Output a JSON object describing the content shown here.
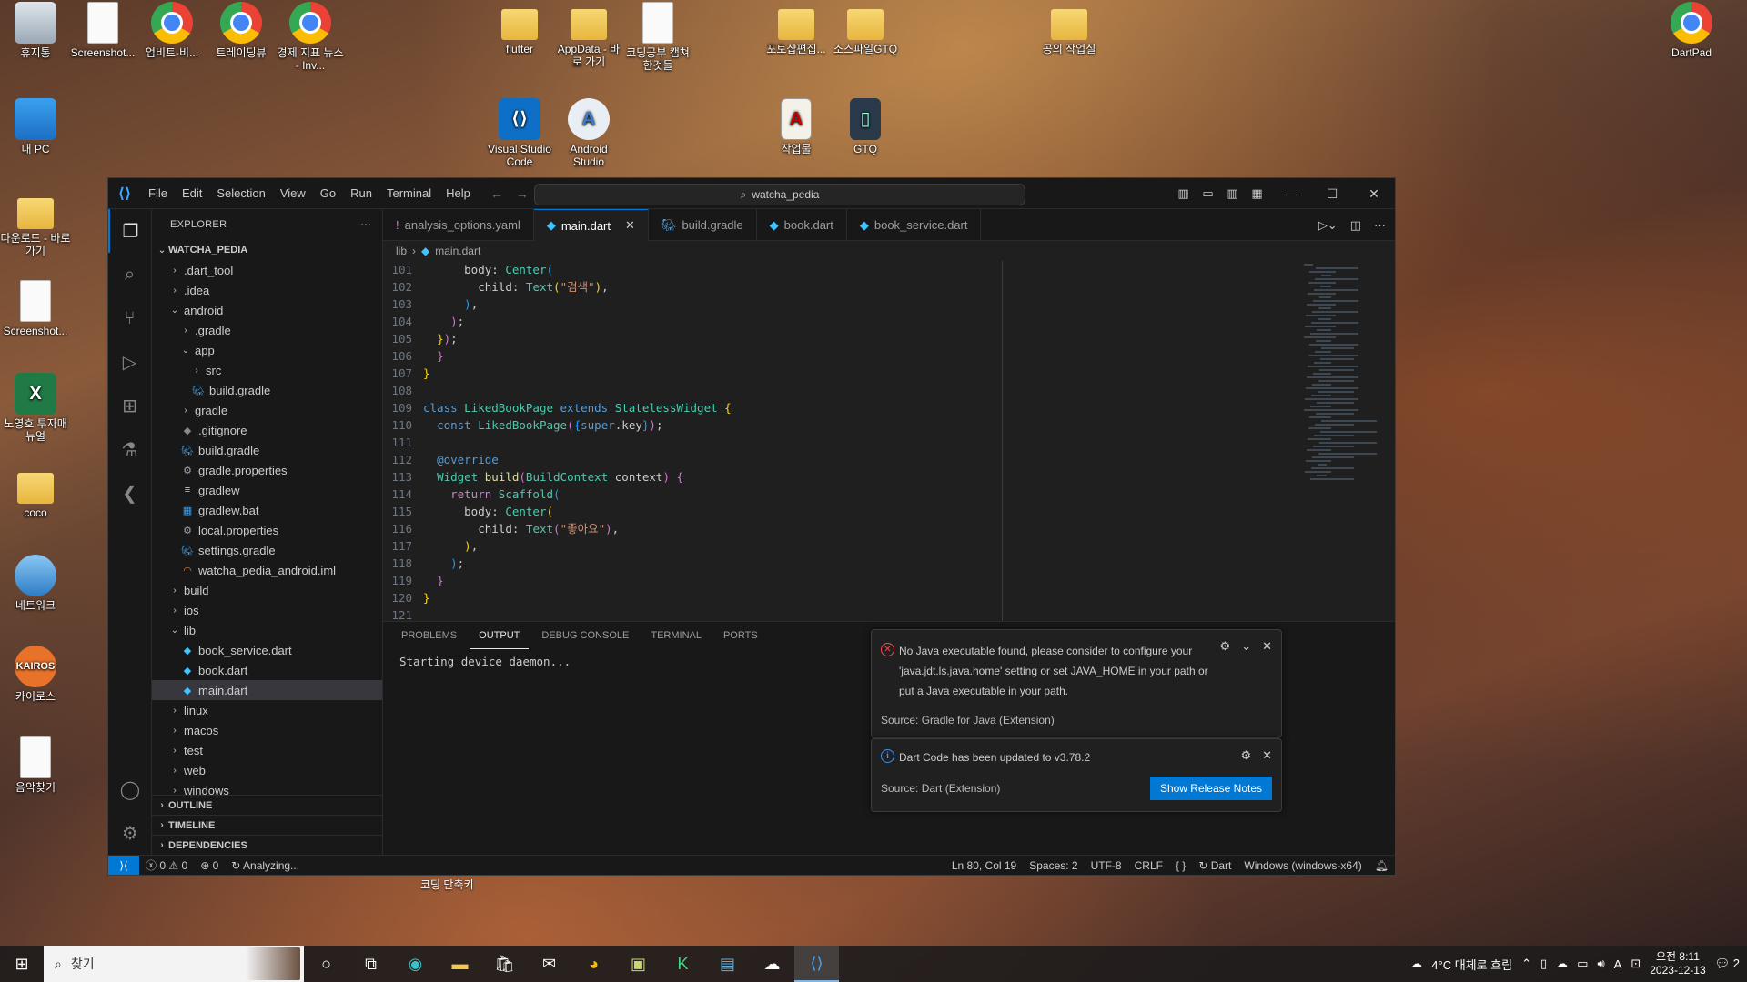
{
  "desktop": {
    "icons": [
      {
        "label": "휴지통",
        "icon": "recycle-bin-icon"
      },
      {
        "label": "Screenshot...",
        "icon": "document-icon"
      },
      {
        "label": "업비트-비...",
        "icon": "chrome-icon"
      },
      {
        "label": "트레이딩뷰",
        "icon": "chrome-icon"
      },
      {
        "label": "경제 지표 뉴스 - Inv...",
        "icon": "chrome-icon"
      },
      {
        "label": "flutter",
        "icon": "folder-icon"
      },
      {
        "label": "AppData - 바로 가기",
        "icon": "folder-icon"
      },
      {
        "label": "코딩공부 캡쳐한것들",
        "icon": "document-icon"
      },
      {
        "label": "포토샵편집...",
        "icon": "folder-icon"
      },
      {
        "label": "소스파일GTQ",
        "icon": "folder-icon"
      },
      {
        "label": "공의 작업실",
        "icon": "folder-icon"
      },
      {
        "label": "DartPad",
        "icon": "chrome-icon"
      },
      {
        "label": "내 PC",
        "icon": "pc-icon"
      },
      {
        "label": "Visual Studio Code",
        "icon": "vscode-icon"
      },
      {
        "label": "Android Studio",
        "icon": "android-studio-icon"
      },
      {
        "label": "작업물",
        "icon": "pdf-icon"
      },
      {
        "label": "GTQ",
        "icon": "gtq-icon"
      },
      {
        "label": "다운로드 - 바로 가기",
        "icon": "folder-icon"
      },
      {
        "label": "Screenshot...",
        "icon": "document-icon"
      },
      {
        "label": "노영호 투자매뉴얼",
        "icon": "excel-icon"
      },
      {
        "label": "coco",
        "icon": "user-folder-icon"
      },
      {
        "label": "네트워크",
        "icon": "network-icon"
      },
      {
        "label": "카이로스",
        "icon": "kairos-icon"
      },
      {
        "label": "음악찾기",
        "icon": "document-icon"
      }
    ],
    "floating_label": "코딩 단축키"
  },
  "vscode": {
    "menu": [
      "File",
      "Edit",
      "Selection",
      "View",
      "Go",
      "Run",
      "Terminal",
      "Help"
    ],
    "command_center": "watcha_pedia",
    "explorer": {
      "title": "EXPLORER",
      "root": "WATCHA_PEDIA",
      "items": [
        {
          "label": ".dart_tool",
          "type": "folder",
          "open": false,
          "depth": 1
        },
        {
          "label": ".idea",
          "type": "folder",
          "open": false,
          "depth": 1
        },
        {
          "label": "android",
          "type": "folder",
          "open": true,
          "depth": 1
        },
        {
          "label": ".gradle",
          "type": "folder",
          "open": false,
          "depth": 2
        },
        {
          "label": "app",
          "type": "folder",
          "open": true,
          "depth": 2
        },
        {
          "label": "src",
          "type": "folder",
          "open": false,
          "depth": 3
        },
        {
          "label": "build.gradle",
          "type": "gradle",
          "depth": 3
        },
        {
          "label": "gradle",
          "type": "folder",
          "open": false,
          "depth": 2
        },
        {
          "label": ".gitignore",
          "type": "git",
          "depth": 2
        },
        {
          "label": "build.gradle",
          "type": "gradle",
          "depth": 2
        },
        {
          "label": "gradle.properties",
          "type": "settings",
          "depth": 2
        },
        {
          "label": "gradlew",
          "type": "text",
          "depth": 2
        },
        {
          "label": "gradlew.bat",
          "type": "windows",
          "depth": 2
        },
        {
          "label": "local.properties",
          "type": "settings",
          "depth": 2
        },
        {
          "label": "settings.gradle",
          "type": "gradle",
          "depth": 2
        },
        {
          "label": "watcha_pedia_android.iml",
          "type": "rss",
          "depth": 2
        },
        {
          "label": "build",
          "type": "folder",
          "open": false,
          "depth": 1
        },
        {
          "label": "ios",
          "type": "folder",
          "open": false,
          "depth": 1
        },
        {
          "label": "lib",
          "type": "folder",
          "open": true,
          "depth": 1
        },
        {
          "label": "book_service.dart",
          "type": "dart",
          "depth": 2
        },
        {
          "label": "book.dart",
          "type": "dart",
          "depth": 2
        },
        {
          "label": "main.dart",
          "type": "dart",
          "depth": 2,
          "selected": true
        },
        {
          "label": "linux",
          "type": "folder",
          "open": false,
          "depth": 1
        },
        {
          "label": "macos",
          "type": "folder",
          "open": false,
          "depth": 1
        },
        {
          "label": "test",
          "type": "folder",
          "open": false,
          "depth": 1
        },
        {
          "label": "web",
          "type": "folder",
          "open": false,
          "depth": 1
        },
        {
          "label": "windows",
          "type": "folder",
          "open": false,
          "depth": 1
        }
      ],
      "sections": [
        "OUTLINE",
        "TIMELINE",
        "DEPENDENCIES"
      ]
    },
    "tabs": [
      {
        "label": "analysis_options.yaml",
        "icon": "!",
        "active": false
      },
      {
        "label": "main.dart",
        "icon": "dart",
        "active": true
      },
      {
        "label": "build.gradle",
        "icon": "gradle",
        "active": false
      },
      {
        "label": "book.dart",
        "icon": "dart",
        "active": false
      },
      {
        "label": "book_service.dart",
        "icon": "dart",
        "active": false
      }
    ],
    "breadcrumb": [
      "lib",
      "main.dart"
    ],
    "code_lines": [
      {
        "n": "101",
        "t": [
          [
            "      ",
            ""
          ],
          [
            "body",
            ""
          ],
          [
            ": ",
            ""
          ],
          [
            "Center",
            "k-type"
          ],
          [
            "(",
            "k-b3"
          ]
        ]
      },
      {
        "n": "102",
        "t": [
          [
            "        ",
            ""
          ],
          [
            "child",
            ""
          ],
          [
            ": ",
            ""
          ],
          [
            "Text",
            "k-type"
          ],
          [
            "(",
            "k-b1"
          ],
          [
            "\"검색\"",
            "k-str"
          ],
          [
            ")",
            "k-b1"
          ],
          [
            ",",
            ""
          ]
        ]
      },
      {
        "n": "103",
        "t": [
          [
            "      ",
            ""
          ],
          [
            ")",
            "k-b3"
          ],
          [
            ",",
            ""
          ]
        ]
      },
      {
        "n": "104",
        "t": [
          [
            "    ",
            ""
          ],
          [
            ")",
            "k-b2"
          ],
          [
            ";",
            ""
          ]
        ]
      },
      {
        "n": "105",
        "t": [
          [
            "  ",
            ""
          ],
          [
            "}",
            "k-b1"
          ],
          [
            ")",
            "k-b2"
          ],
          [
            ";",
            ""
          ]
        ]
      },
      {
        "n": "106",
        "t": [
          [
            "  ",
            ""
          ],
          [
            "}",
            "k-b2"
          ]
        ]
      },
      {
        "n": "107",
        "t": [
          [
            "}",
            "k-b1"
          ]
        ]
      },
      {
        "n": "108",
        "t": []
      },
      {
        "n": "109",
        "t": [
          [
            "class ",
            "k-kw"
          ],
          [
            "LikedBookPage ",
            "k-type"
          ],
          [
            "extends ",
            "k-kw"
          ],
          [
            "StatelessWidget ",
            "k-type"
          ],
          [
            "{",
            "k-b1"
          ]
        ]
      },
      {
        "n": "110",
        "t": [
          [
            "  ",
            ""
          ],
          [
            "const ",
            "k-kw"
          ],
          [
            "LikedBookPage",
            "k-type"
          ],
          [
            "(",
            "k-b2"
          ],
          [
            "{",
            "k-b3"
          ],
          [
            "super",
            "k-kw"
          ],
          [
            ".key",
            ""
          ],
          [
            "}",
            "k-b3"
          ],
          [
            ")",
            "k-b2"
          ],
          [
            ";",
            ""
          ]
        ]
      },
      {
        "n": "111",
        "t": []
      },
      {
        "n": "112",
        "t": [
          [
            "  ",
            ""
          ],
          [
            "@override",
            "k-ann"
          ]
        ]
      },
      {
        "n": "113",
        "t": [
          [
            "  ",
            ""
          ],
          [
            "Widget ",
            "k-type"
          ],
          [
            "build",
            "k-fn"
          ],
          [
            "(",
            "k-b2"
          ],
          [
            "BuildContext ",
            "k-type"
          ],
          [
            "context",
            ""
          ],
          [
            ")",
            "k-b2"
          ],
          [
            " {",
            "k-b2"
          ]
        ]
      },
      {
        "n": "114",
        "t": [
          [
            "    ",
            ""
          ],
          [
            "return ",
            "k-ctrl"
          ],
          [
            "Scaffold",
            "k-type"
          ],
          [
            "(",
            "k-b3"
          ]
        ]
      },
      {
        "n": "115",
        "t": [
          [
            "      ",
            ""
          ],
          [
            "body",
            ""
          ],
          [
            ": ",
            ""
          ],
          [
            "Center",
            "k-type"
          ],
          [
            "(",
            "k-b1"
          ]
        ]
      },
      {
        "n": "116",
        "t": [
          [
            "        ",
            ""
          ],
          [
            "child",
            ""
          ],
          [
            ": ",
            ""
          ],
          [
            "Text",
            "k-type"
          ],
          [
            "(",
            "k-b2"
          ],
          [
            "\"좋아요\"",
            "k-str"
          ],
          [
            ")",
            "k-b2"
          ],
          [
            ",",
            ""
          ]
        ]
      },
      {
        "n": "117",
        "t": [
          [
            "      ",
            ""
          ],
          [
            ")",
            "k-b1"
          ],
          [
            ",",
            ""
          ]
        ]
      },
      {
        "n": "118",
        "t": [
          [
            "    ",
            ""
          ],
          [
            ")",
            "k-b3"
          ],
          [
            ";",
            ""
          ]
        ]
      },
      {
        "n": "119",
        "t": [
          [
            "  ",
            ""
          ],
          [
            "}",
            "k-b2"
          ]
        ]
      },
      {
        "n": "120",
        "t": [
          [
            "}",
            "k-b1"
          ]
        ]
      },
      {
        "n": "121",
        "t": []
      }
    ],
    "panel": {
      "tabs": [
        "PROBLEMS",
        "OUTPUT",
        "DEBUG CONSOLE",
        "TERMINAL",
        "PORTS"
      ],
      "active_tab": "OUTPUT",
      "output": "Starting device daemon..."
    },
    "notifications": [
      {
        "type": "error",
        "message": "No Java executable found, please consider to configure your 'java.jdt.ls.java.home' setting or set JAVA_HOME in your path or put a Java executable in your path.",
        "source": "Source: Gradle for Java (Extension)"
      },
      {
        "type": "info",
        "message": "Dart Code has been updated to v3.78.2",
        "source": "Source: Dart (Extension)",
        "button": "Show Release Notes"
      }
    ],
    "status": {
      "errors": "0",
      "warnings": "0",
      "ports": "0",
      "analyzing": "Analyzing...",
      "position": "Ln 80, Col 19",
      "spaces": "Spaces: 2",
      "encoding": "UTF-8",
      "eol": "CRLF",
      "braces": "{ }",
      "language": "Dart",
      "platform": "Windows (windows-x64)"
    }
  },
  "taskbar": {
    "search_placeholder": "찾기",
    "weather": "4°C  대체로 흐림",
    "ime": "A",
    "time": "오전 8:11",
    "date": "2023-12-13",
    "notification_count": "2"
  }
}
